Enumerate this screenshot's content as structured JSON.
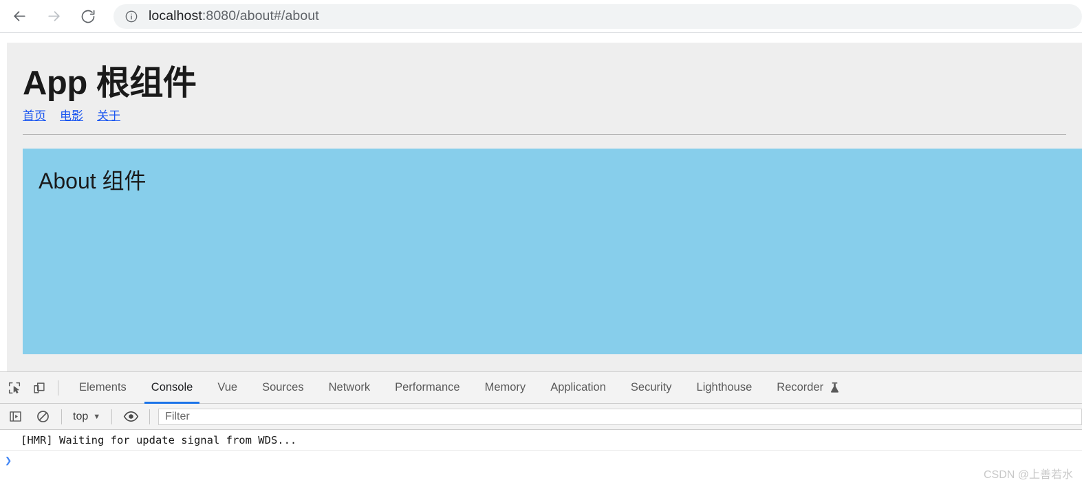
{
  "browser": {
    "back_label": "Back",
    "forward_label": "Forward",
    "reload_label": "Reload",
    "site_info_icon": "info-circle-icon",
    "url_host": "localhost",
    "url_rest": ":8080/about#/about",
    "url_full": "localhost:8080/about#/about"
  },
  "page": {
    "title": "App 根组件",
    "links": [
      {
        "label": "首页"
      },
      {
        "label": "电影"
      },
      {
        "label": "关于"
      }
    ],
    "component": {
      "title": "About 组件",
      "background_color": "#87ceeb"
    },
    "background_color": "#eeeeee"
  },
  "devtools": {
    "inspect_icon": "inspect-element-icon",
    "device_icon": "device-toolbar-icon",
    "tabs": [
      {
        "label": "Elements",
        "active": false
      },
      {
        "label": "Console",
        "active": true
      },
      {
        "label": "Vue",
        "active": false
      },
      {
        "label": "Sources",
        "active": false
      },
      {
        "label": "Network",
        "active": false
      },
      {
        "label": "Performance",
        "active": false
      },
      {
        "label": "Memory",
        "active": false
      },
      {
        "label": "Application",
        "active": false
      },
      {
        "label": "Security",
        "active": false
      },
      {
        "label": "Lighthouse",
        "active": false
      },
      {
        "label": "Recorder",
        "active": false,
        "icon": "flask-icon"
      }
    ],
    "active_tab_color": "#1a73e8",
    "console_toolbar": {
      "sidebar_icon": "show-console-sidebar-icon",
      "clear_icon": "clear-console-icon",
      "context": "top",
      "context_caret": "▼",
      "eye_icon": "live-expression-eye-icon",
      "filter_placeholder": "Filter",
      "filter_value": ""
    },
    "console_messages": [
      {
        "text": "[HMR] Waiting for update signal from WDS..."
      }
    ],
    "prompt_caret": "❯"
  },
  "watermark": {
    "text": "CSDN @上善若水"
  }
}
